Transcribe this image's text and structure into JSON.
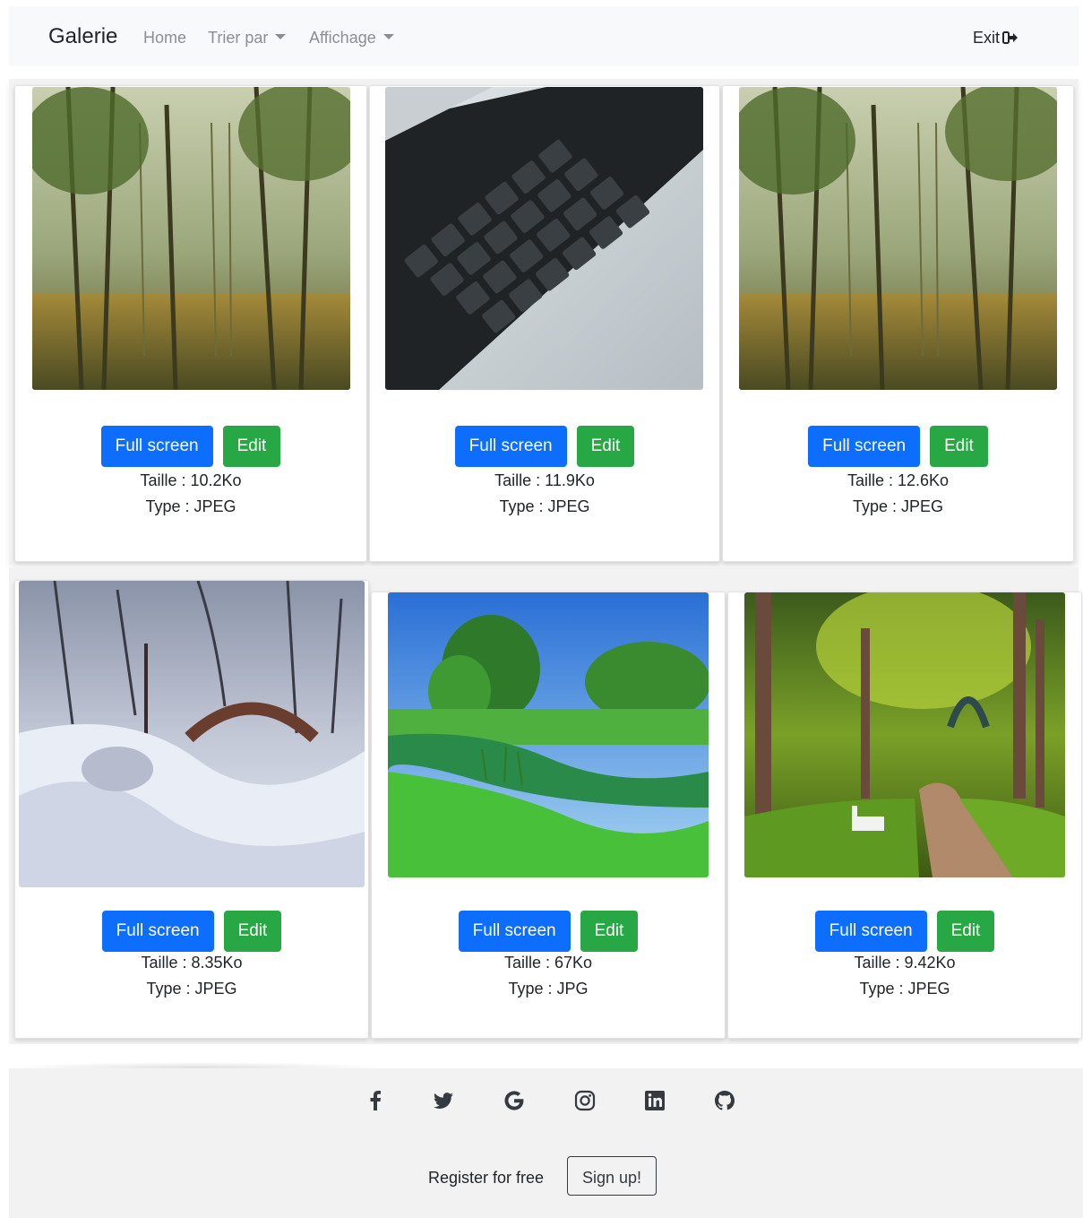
{
  "navbar": {
    "brand": "Galerie",
    "home": "Home",
    "sort": "Trier par",
    "display": "Affichage",
    "exit": "Exit"
  },
  "buttons": {
    "fullscreen": "Full screen",
    "edit": "Edit"
  },
  "cards": [
    {
      "size": "Taille : 10.2Ko",
      "type": "Type : JPEG",
      "image": "forest-photo"
    },
    {
      "size": "Taille : 11.9Ko",
      "type": "Type : JPEG",
      "image": "keyboard-photo"
    },
    {
      "size": "Taille : 12.6Ko",
      "type": "Type : JPEG",
      "image": "forest-photo"
    },
    {
      "size": "Taille : 8.35Ko",
      "type": "Type : JPEG",
      "image": "snow-bridge-photo"
    },
    {
      "size": "Taille : 67Ko",
      "type": "Type : JPG",
      "image": "river-landscape-photo"
    },
    {
      "size": "Taille : 9.42Ko",
      "type": "Type : JPEG",
      "image": "park-path-photo"
    }
  ],
  "footer": {
    "icons": [
      "facebook-icon",
      "twitter-icon",
      "google-icon",
      "instagram-icon",
      "linkedin-icon",
      "github-icon"
    ],
    "register": "Register for free",
    "signup": "Sign up!"
  },
  "colors": {
    "primary": "#0d6efd",
    "success": "#28a745",
    "navbar": "#f8f9fa",
    "footer": "#f2f2f2"
  }
}
